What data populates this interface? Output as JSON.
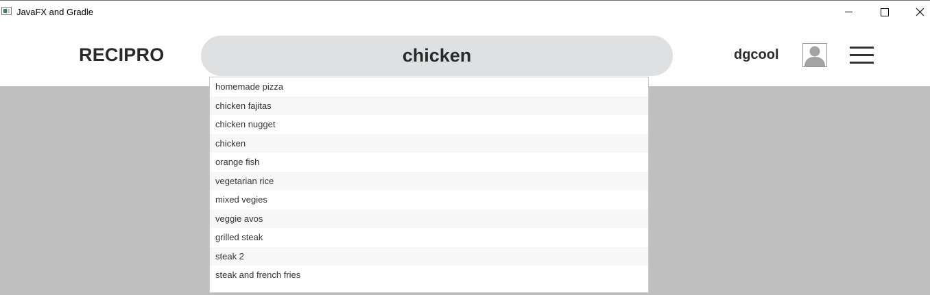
{
  "window": {
    "title": "JavaFX and Gradle",
    "app_icon": "javafx-window-icon",
    "controls": {
      "minimize_icon": "minimize-icon",
      "maximize_icon": "maximize-icon",
      "close_icon": "close-icon"
    }
  },
  "header": {
    "logo": "RECIPRO",
    "search": {
      "value": "chicken",
      "placeholder": ""
    },
    "username": "dgcool",
    "avatar_icon": "user-avatar-icon",
    "menu_icon": "hamburger-menu-icon"
  },
  "dropdown": {
    "items": [
      "homemade pizza",
      "chicken fajitas",
      "chicken nugget",
      "chicken",
      "orange fish",
      "vegetarian rice",
      "mixed vegies",
      "veggie avos",
      "grilled steak",
      "steak 2",
      "steak and french fries"
    ]
  },
  "colors": {
    "content_background": "#bfbfbf",
    "search_background": "#dfe0e2",
    "text_dark": "#2a2a2a"
  }
}
